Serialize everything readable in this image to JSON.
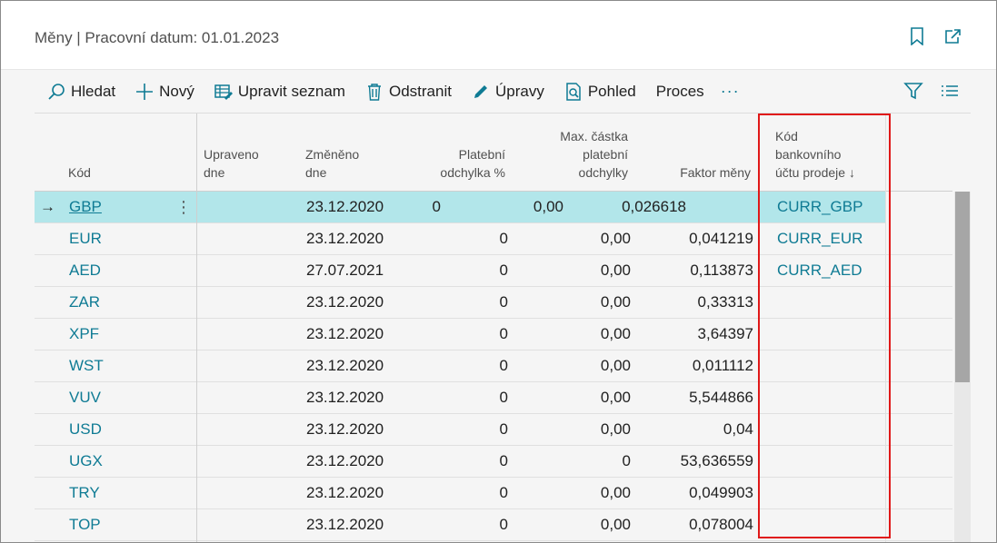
{
  "window": {
    "title": "Měny | Pracovní datum: 01.01.2023"
  },
  "actions": {
    "search": "Hledat",
    "new": "Nový",
    "edit_list": "Upravit seznam",
    "delete": "Odstranit",
    "edit": "Úpravy",
    "view": "Pohled",
    "process": "Proces",
    "more": "···"
  },
  "columns": {
    "code": "Kód",
    "modified_line1": "Upraveno",
    "modified_line2": "dne",
    "changed_line1": "Změněno",
    "changed_line2": "dne",
    "pay_tol_pct_line1": "Platební",
    "pay_tol_pct_line2": "odchylka %",
    "max_pay_tol_line1": "Max. částka",
    "max_pay_tol_line2": "platební",
    "max_pay_tol_line3": "odchylky",
    "factor": "Faktor měny",
    "bank_code_line1": "Kód",
    "bank_code_line2": "bankovního",
    "bank_code_line3": "účtu prodeje",
    "sort_indicator": "↓"
  },
  "rows": [
    {
      "code": "GBP",
      "modified": "",
      "changed": "23.12.2020",
      "pay_tol_pct": "0",
      "max_pay_tol": "0,00",
      "factor": "0,026618",
      "bank": "CURR_GBP"
    },
    {
      "code": "EUR",
      "modified": "",
      "changed": "23.12.2020",
      "pay_tol_pct": "0",
      "max_pay_tol": "0,00",
      "factor": "0,041219",
      "bank": "CURR_EUR"
    },
    {
      "code": "AED",
      "modified": "",
      "changed": "27.07.2021",
      "pay_tol_pct": "0",
      "max_pay_tol": "0,00",
      "factor": "0,113873",
      "bank": "CURR_AED"
    },
    {
      "code": "ZAR",
      "modified": "",
      "changed": "23.12.2020",
      "pay_tol_pct": "0",
      "max_pay_tol": "0,00",
      "factor": "0,33313",
      "bank": ""
    },
    {
      "code": "XPF",
      "modified": "",
      "changed": "23.12.2020",
      "pay_tol_pct": "0",
      "max_pay_tol": "0,00",
      "factor": "3,64397",
      "bank": ""
    },
    {
      "code": "WST",
      "modified": "",
      "changed": "23.12.2020",
      "pay_tol_pct": "0",
      "max_pay_tol": "0,00",
      "factor": "0,011112",
      "bank": ""
    },
    {
      "code": "VUV",
      "modified": "",
      "changed": "23.12.2020",
      "pay_tol_pct": "0",
      "max_pay_tol": "0,00",
      "factor": "5,544866",
      "bank": ""
    },
    {
      "code": "USD",
      "modified": "",
      "changed": "23.12.2020",
      "pay_tol_pct": "0",
      "max_pay_tol": "0,00",
      "factor": "0,04",
      "bank": ""
    },
    {
      "code": "UGX",
      "modified": "",
      "changed": "23.12.2020",
      "pay_tol_pct": "0",
      "max_pay_tol": "0",
      "factor": "53,636559",
      "bank": ""
    },
    {
      "code": "TRY",
      "modified": "",
      "changed": "23.12.2020",
      "pay_tol_pct": "0",
      "max_pay_tol": "0,00",
      "factor": "0,049903",
      "bank": ""
    },
    {
      "code": "TOP",
      "modified": "",
      "changed": "23.12.2020",
      "pay_tol_pct": "0",
      "max_pay_tol": "0,00",
      "factor": "0,078004",
      "bank": ""
    }
  ],
  "selected_row": 0,
  "row_marker": "→",
  "row_menu": "⋮",
  "colors": {
    "accent": "#0f7b94",
    "selected_row": "#b2e6ea",
    "highlight_box": "#e01818"
  }
}
